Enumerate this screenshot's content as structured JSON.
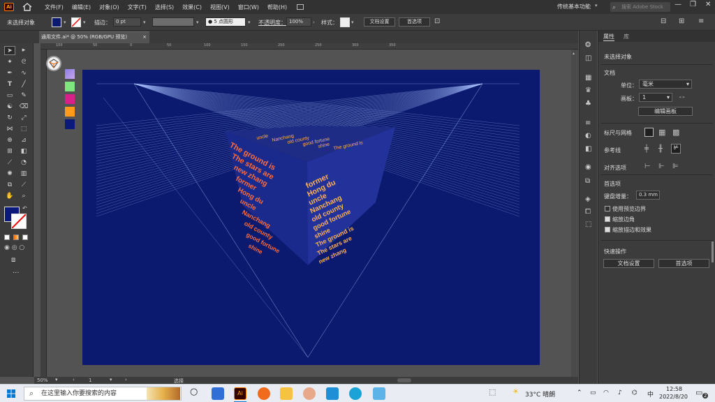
{
  "menubar": {
    "app_logo": "Ai",
    "items": [
      "文件(F)",
      "编辑(E)",
      "对象(O)",
      "文字(T)",
      "选择(S)",
      "效果(C)",
      "视图(V)",
      "窗口(W)",
      "帮助(H)"
    ],
    "workspace": "传统基本功能",
    "stock_search_placeholder": "搜索 Adobe Stock"
  },
  "controlbar": {
    "selection_status": "未选择对象",
    "stroke_label": "描边：",
    "stroke_value": "0 pt",
    "brush_value": "5 点圆形",
    "opacity_label": "不透明度：",
    "opacity_value": "100%",
    "style_label": "样式：",
    "doc_setup": "文档设置",
    "preferences": "首选项"
  },
  "doc_tab": {
    "title": "通用文件.ai* @ 50% (RGB/GPU 预览)",
    "close": "×"
  },
  "ruler": {
    "top_ticks": [
      "100",
      "50",
      "0",
      "50",
      "100",
      "150",
      "200",
      "250",
      "300",
      "350"
    ]
  },
  "statusbar": {
    "zoom": "50%",
    "artboard_num": "1",
    "tool_name": "选择"
  },
  "properties": {
    "tab_properties": "属性",
    "tab_other": "库",
    "no_selection": "未选择对象",
    "document_header": "文档",
    "units_label": "单位：",
    "units_value": "毫米",
    "artboard_label": "画板：",
    "artboard_value": "1",
    "edit_artboard_btn": "编辑画板",
    "rulers_grids": "标尺与网格",
    "guides": "参考线",
    "snap_options": "对齐选项",
    "preferences_header": "首选项",
    "keyboard_increment_label": "键盘增量：",
    "keyboard_increment_value": "0.3 mm",
    "use_preview_bounds": "使用预览边界",
    "scale_corners": "缩放边角",
    "scale_strokes_effects": "缩放描边和效果",
    "quick_actions": "快速操作",
    "doc_setup_btn": "文档设置",
    "preferences_btn": "首选项"
  },
  "taskbar": {
    "search_placeholder": "在这里输入你要搜索的内容",
    "weather": "33°C 晴朗",
    "ime": "中",
    "time": "12:58",
    "date": "2022/8/20",
    "notification_count": "2"
  },
  "artwork": {
    "cube_text": [
      "The ground is",
      "The stars are",
      "new zhang",
      "former",
      "Hong du",
      "uncle",
      "Nanchang",
      "old county",
      "good fortune",
      "shine"
    ],
    "colors": {
      "artboard": "#0b1a6e",
      "text_left": "#ff6b3a",
      "text_right": "#ffb050",
      "grid_lines": "#a9c2ff",
      "swatch_1": "#8e7de0",
      "swatch_2": "#7fe57f",
      "swatch_3": "#d81f8a",
      "swatch_4": "#ff9a1a",
      "swatch_5": "#0b1a7a"
    }
  }
}
